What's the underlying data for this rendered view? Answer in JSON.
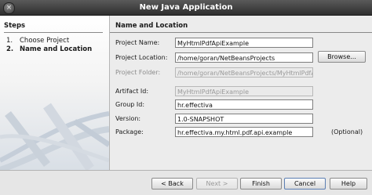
{
  "window": {
    "title": "New Java Application",
    "close_icon": "×"
  },
  "steps": {
    "header": "Steps",
    "items": [
      {
        "num": "1.",
        "label": "Choose Project"
      },
      {
        "num": "2.",
        "label": "Name and Location"
      }
    ]
  },
  "panel": {
    "header": "Name and Location",
    "project_name": {
      "label": "Project Name:",
      "value": "MyHtmlPdfApiExample"
    },
    "project_location": {
      "label": "Project Location:",
      "value": "/home/goran/NetBeansProjects",
      "browse": "Browse..."
    },
    "project_folder": {
      "label": "Project Folder:",
      "value": "/home/goran/NetBeansProjects/MyHtmlPdfA"
    },
    "artifact_id": {
      "label": "Artifact Id:",
      "value": "MyHtmlPdfApiExample"
    },
    "group_id": {
      "label": "Group Id:",
      "value": "hr.effectiva"
    },
    "version": {
      "label": "Version:",
      "value": "1.0-SNAPSHOT"
    },
    "package": {
      "label": "Package:",
      "value": "hr.effectiva.my.html.pdf.api.example",
      "optional": "(Optional)"
    }
  },
  "buttons": {
    "back": "< Back",
    "next": "Next >",
    "finish": "Finish",
    "cancel": "Cancel",
    "help": "Help"
  }
}
